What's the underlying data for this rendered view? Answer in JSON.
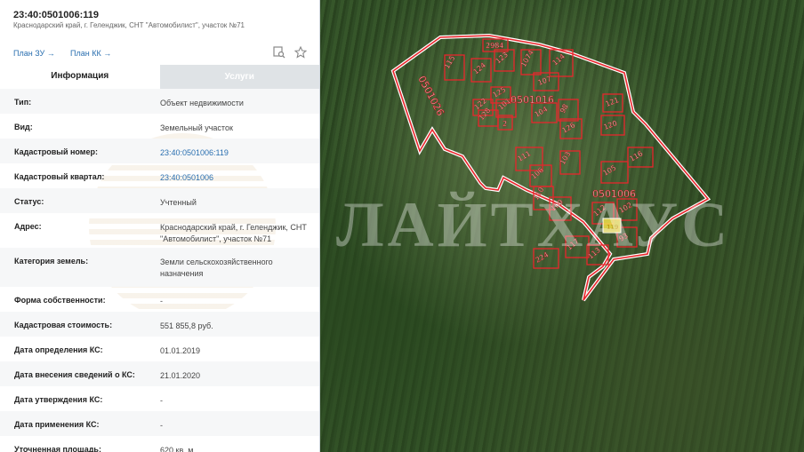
{
  "header": {
    "cadastral_number": "23:40:0501006:119",
    "address": "Краснодарский край, г. Геленджик, СНТ \"Автомобилист\", участок №71"
  },
  "links": {
    "plan_zu": "План ЗУ",
    "plan_kk": "План КК"
  },
  "tabs": {
    "info": "Информация",
    "services": "Услуги"
  },
  "rows": [
    {
      "label": "Тип:",
      "value": "Объект недвижимости"
    },
    {
      "label": "Вид:",
      "value": "Земельный участок"
    },
    {
      "label": "Кадастровый номер:",
      "value": "23:40:0501006:119"
    },
    {
      "label": "Кадастровый квартал:",
      "value": "23:40:0501006"
    },
    {
      "label": "Статус:",
      "value": "Учтенный"
    },
    {
      "label": "Адрес:",
      "value": "Краснодарский край, г. Геленджик, СНТ \"Автомобилист\", участок №71"
    },
    {
      "label": "Категория земель:",
      "value": "Земли сельскохозяйственного назначения"
    },
    {
      "label": "Форма собственности:",
      "value": "-"
    },
    {
      "label": "Кадастровая стоимость:",
      "value": "551 855,8 руб."
    },
    {
      "label": "Дата определения КС:",
      "value": "01.01.2019"
    },
    {
      "label": "Дата внесения сведений о КС:",
      "value": "21.01.2020"
    },
    {
      "label": "Дата утверждения КС:",
      "value": "-"
    },
    {
      "label": "Дата применения КС:",
      "value": "-"
    },
    {
      "label": "Уточненная площадь:",
      "value": "620 кв. м"
    }
  ],
  "map": {
    "watermark": "ЛАЙТХАУС",
    "quarter_labels": [
      "0501026",
      "0501016",
      "0501006"
    ],
    "parcel_labels": [
      "2984",
      "115",
      "124",
      "123",
      "1074",
      "114",
      "107",
      "125",
      "122",
      "101",
      "128",
      "2",
      "104",
      "98",
      "121",
      "126",
      "120",
      "111",
      "106",
      "103",
      "109",
      "105",
      "110",
      "112",
      "119",
      "102",
      "93",
      "117",
      "113",
      "224",
      "116"
    ],
    "colors": {
      "boundary": "#e8262c",
      "selected": "#f3e24a"
    }
  }
}
